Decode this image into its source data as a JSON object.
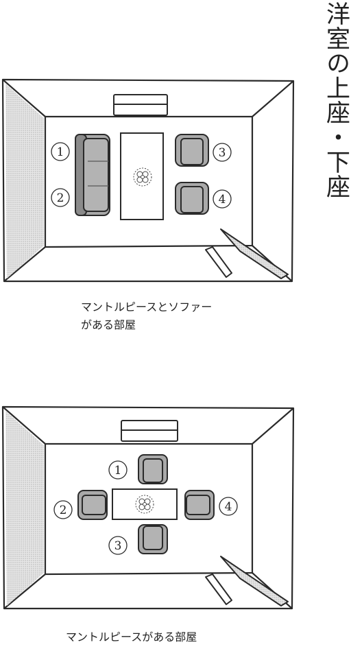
{
  "title": "洋室の上座・下座",
  "room1": {
    "caption_line1": "マントルピースとソファー",
    "caption_line2": "がある部屋",
    "seats": [
      "1",
      "2",
      "3",
      "4"
    ]
  },
  "room2": {
    "caption": "マントルピースがある部屋",
    "seats": [
      "1",
      "2",
      "3",
      "4"
    ]
  },
  "colors": {
    "furniture": "#a9a9a9",
    "furniture_dark": "#8a8a8a",
    "line": "#2a2a2a",
    "shade": "#c8c8c8"
  }
}
